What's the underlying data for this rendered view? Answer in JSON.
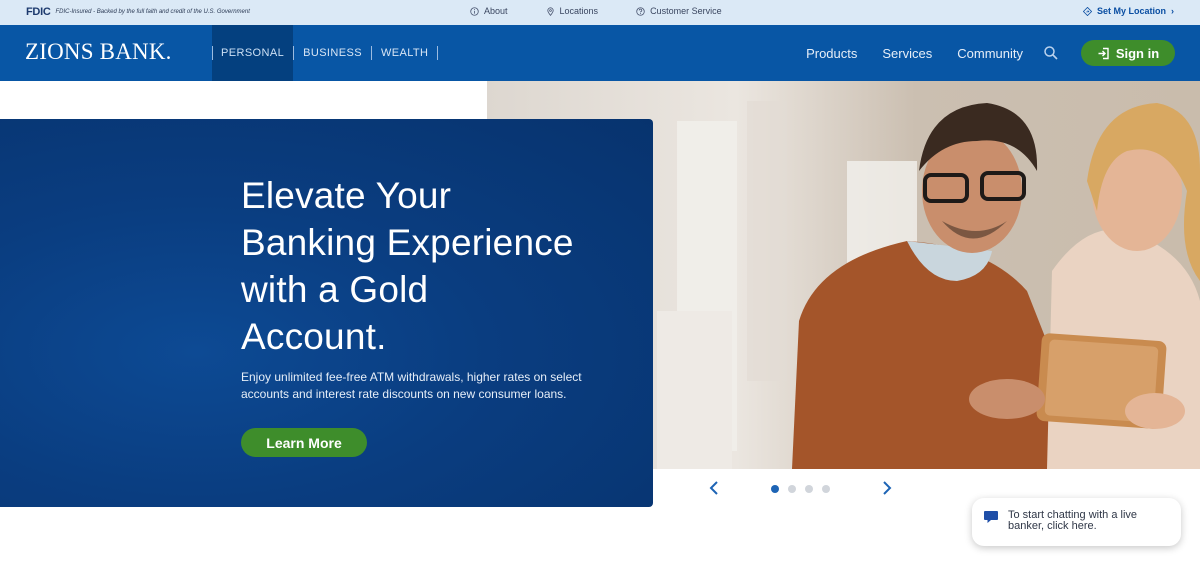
{
  "utility_bar": {
    "fdic_logo": "FDIC",
    "fdic_text": "FDIC-Insured - Backed by the full faith and credit of the U.S. Government",
    "links": [
      {
        "label": "About",
        "icon": "info-icon"
      },
      {
        "label": "Locations",
        "icon": "location-pin-icon"
      },
      {
        "label": "Customer Service",
        "icon": "question-icon"
      }
    ],
    "set_location": "Set My Location",
    "set_location_icon": "diamond-arrow-icon"
  },
  "nav": {
    "brand": "ZIONS BANK.",
    "segments": [
      {
        "label": "PERSONAL",
        "active": true
      },
      {
        "label": "BUSINESS",
        "active": false
      },
      {
        "label": "WEALTH",
        "active": false
      }
    ],
    "links": [
      "Products",
      "Services",
      "Community"
    ],
    "search_icon": "search-icon",
    "signin_label": "Sign in",
    "signin_icon": "sign-in-icon"
  },
  "hero": {
    "title_lines": [
      "Elevate Your",
      "Banking Experience",
      "with a Gold",
      "Account."
    ],
    "subtitle": "Enjoy unlimited fee-free ATM withdrawals, higher rates on select accounts and interest rate discounts on new consumer loans.",
    "cta_label": "Learn More"
  },
  "carousel": {
    "slide_count": 4,
    "active_index": 0,
    "prev_icon": "chevron-left-icon",
    "next_icon": "chevron-right-icon"
  },
  "chat": {
    "text": "To start chatting with a live banker, click here.",
    "icon": "chat-bubble-icon"
  },
  "colors": {
    "top_bar": "#dbe9f6",
    "nav_blue": "#0856a5",
    "hero_blue": "#0a3d80",
    "accent_green": "#3e8d2b"
  }
}
